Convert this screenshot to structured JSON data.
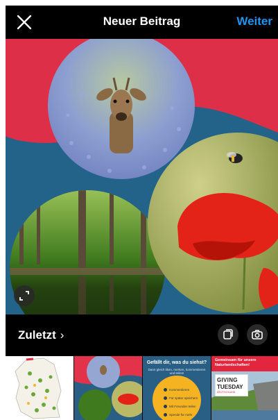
{
  "header": {
    "title": "Neuer Beitrag",
    "next_label": "Weiter",
    "close_icon": "close-icon"
  },
  "gallery": {
    "recent_label": "Zuletzt",
    "recent_chevron": "›",
    "multi_select_icon": "multi-select-icon",
    "camera_icon": "camera-icon",
    "expand_icon": "expand-icon"
  },
  "colors": {
    "accent": "#1f95f0",
    "background": "#000000",
    "collage_red": "#dd3048",
    "collage_blue": "#236289"
  },
  "thumbnails": [
    {
      "name": "map-of-germany-thumbnail"
    },
    {
      "name": "collage-thumbnail"
    },
    {
      "name": "infographic-thumbnail",
      "title": "Gefällt dir, was du siehst?",
      "subtitle": "Dann gleich liken, merken, kommentieren und teilen!",
      "items": [
        "Kommentieren",
        "Für später speichern",
        "Mit Freunden teilen",
        "Spende für mehr"
      ]
    },
    {
      "name": "giving-tuesday-thumbnail",
      "title": "Gemeinsam für unsere Naturlandschaften!",
      "logo_line1": "GIVING",
      "logo_line2": "TUESDAY",
      "logo_line3": "DEUTSCHLAND"
    }
  ]
}
